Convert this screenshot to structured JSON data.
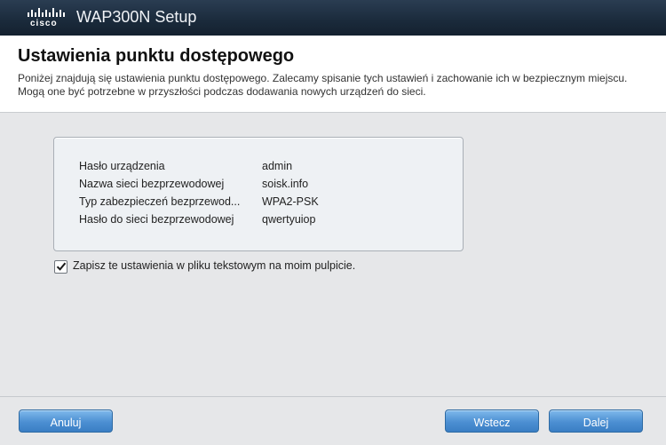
{
  "window": {
    "brand": "cisco",
    "title": "WAP300N Setup"
  },
  "header": {
    "title": "Ustawienia punktu dostępowego",
    "description": "Poniżej znajdują się ustawienia punktu dostępowego. Zalecamy spisanie tych ustawień i zachowanie ich w bezpiecznym miejscu. Mogą one być potrzebne w przyszłości podczas dodawania nowych urządzeń do sieci."
  },
  "settings": [
    {
      "label": "Hasło urządzenia",
      "value": "admin"
    },
    {
      "label": "Nazwa sieci bezprzewodowej",
      "value": "soisk.info"
    },
    {
      "label": "Typ zabezpieczeń bezprzewod...",
      "value": "WPA2-PSK"
    },
    {
      "label": "Hasło do sieci bezprzewodowej",
      "value": "qwertyuiop"
    }
  ],
  "save_option": {
    "label": "Zapisz te ustawienia w pliku tekstowym na moim pulpicie.",
    "checked": true
  },
  "buttons": {
    "cancel": "Anuluj",
    "back": "Wstecz",
    "next": "Dalej"
  },
  "colors": {
    "titlebar": "#1f3145",
    "button": "#4c8fd2"
  }
}
